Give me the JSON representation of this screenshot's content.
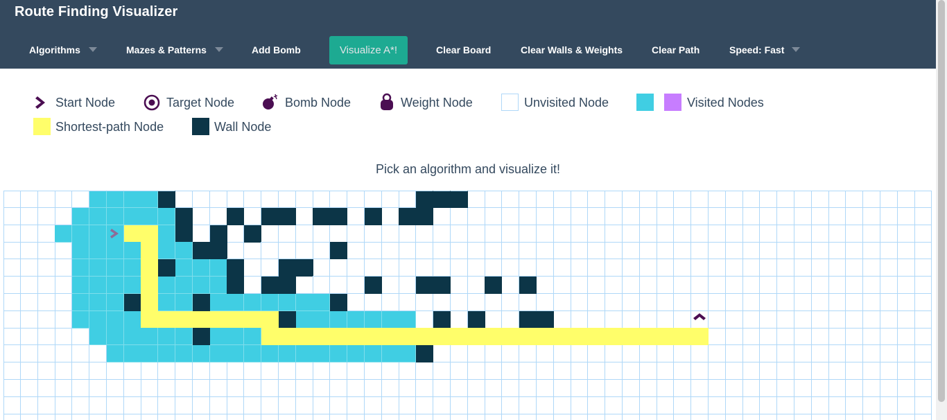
{
  "navbar": {
    "brand": "Route Finding Visualizer",
    "items": [
      {
        "label": "Algorithms",
        "dropdown": true
      },
      {
        "label": "Mazes & Patterns",
        "dropdown": true
      },
      {
        "label": "Add Bomb",
        "dropdown": false
      },
      {
        "label": "Clear Board",
        "dropdown": false
      },
      {
        "label": "Clear Walls & Weights",
        "dropdown": false
      },
      {
        "label": "Clear Path",
        "dropdown": false
      },
      {
        "label": "Speed: Fast",
        "dropdown": true
      }
    ],
    "visualize_label": "Visualize A*!"
  },
  "legend": {
    "start": "Start Node",
    "target": "Target Node",
    "bomb": "Bomb Node",
    "weight": "Weight Node",
    "unvisited": "Unvisited Node",
    "visited": "Visited Nodes",
    "shortest_path": "Shortest-path Node",
    "wall": "Wall Node"
  },
  "colors": {
    "navbar": "#34495e",
    "accent": "#1abc9c",
    "visited_a": "#40cee3",
    "visited_b": "#c77dff",
    "path": "#fffe6a",
    "wall": "#0c3547",
    "node_icon": "#4b0e52"
  },
  "instruction": "Pick an algorithm and visualize it!",
  "grid": {
    "rows": 14,
    "cols": 54,
    "start": [
      2,
      6
    ],
    "target": [
      7,
      40
    ],
    "visited": [
      [
        0,
        5,
        8
      ],
      [
        1,
        4,
        9
      ],
      [
        2,
        3,
        10
      ],
      [
        3,
        4,
        10
      ],
      [
        4,
        4,
        12
      ],
      [
        5,
        4,
        12
      ],
      [
        6,
        4,
        18
      ],
      [
        7,
        4,
        23
      ],
      [
        8,
        5,
        14
      ],
      [
        9,
        6,
        23
      ]
    ],
    "walls": [
      [
        0,
        9
      ],
      [
        0,
        24
      ],
      [
        0,
        25
      ],
      [
        0,
        26
      ],
      [
        1,
        10
      ],
      [
        1,
        13
      ],
      [
        1,
        15
      ],
      [
        1,
        16
      ],
      [
        1,
        18
      ],
      [
        1,
        19
      ],
      [
        1,
        21
      ],
      [
        1,
        23
      ],
      [
        1,
        24
      ],
      [
        2,
        10
      ],
      [
        2,
        12
      ],
      [
        2,
        14
      ],
      [
        3,
        11
      ],
      [
        3,
        12
      ],
      [
        3,
        19
      ],
      [
        4,
        9
      ],
      [
        4,
        13
      ],
      [
        4,
        16
      ],
      [
        4,
        17
      ],
      [
        5,
        13
      ],
      [
        5,
        15
      ],
      [
        5,
        16
      ],
      [
        5,
        21
      ],
      [
        5,
        24
      ],
      [
        5,
        25
      ],
      [
        5,
        28
      ],
      [
        5,
        30
      ],
      [
        6,
        7
      ],
      [
        6,
        11
      ],
      [
        6,
        19
      ],
      [
        7,
        16
      ],
      [
        7,
        25
      ],
      [
        7,
        27
      ],
      [
        7,
        30
      ],
      [
        7,
        31
      ],
      [
        8,
        11
      ],
      [
        9,
        24
      ]
    ],
    "path": [
      [
        2,
        7
      ],
      [
        2,
        8
      ],
      [
        3,
        8
      ],
      [
        4,
        8
      ],
      [
        5,
        8
      ],
      [
        6,
        8
      ],
      [
        7,
        8
      ],
      [
        7,
        9
      ],
      [
        7,
        10
      ],
      [
        7,
        11
      ],
      [
        7,
        12
      ],
      [
        7,
        13
      ],
      [
        7,
        14
      ],
      [
        7,
        15
      ],
      [
        8,
        15
      ],
      [
        8,
        16
      ],
      [
        8,
        17
      ],
      [
        8,
        18
      ],
      [
        8,
        19
      ],
      [
        8,
        20
      ],
      [
        8,
        21
      ],
      [
        8,
        22
      ],
      [
        8,
        23
      ],
      [
        8,
        24
      ],
      [
        8,
        25
      ],
      [
        8,
        26
      ],
      [
        8,
        27
      ],
      [
        8,
        28
      ],
      [
        8,
        29
      ],
      [
        8,
        30
      ],
      [
        8,
        31
      ],
      [
        8,
        32
      ],
      [
        8,
        33
      ],
      [
        8,
        34
      ],
      [
        8,
        35
      ],
      [
        8,
        36
      ],
      [
        8,
        37
      ],
      [
        8,
        38
      ],
      [
        8,
        39
      ],
      [
        8,
        40
      ]
    ]
  }
}
